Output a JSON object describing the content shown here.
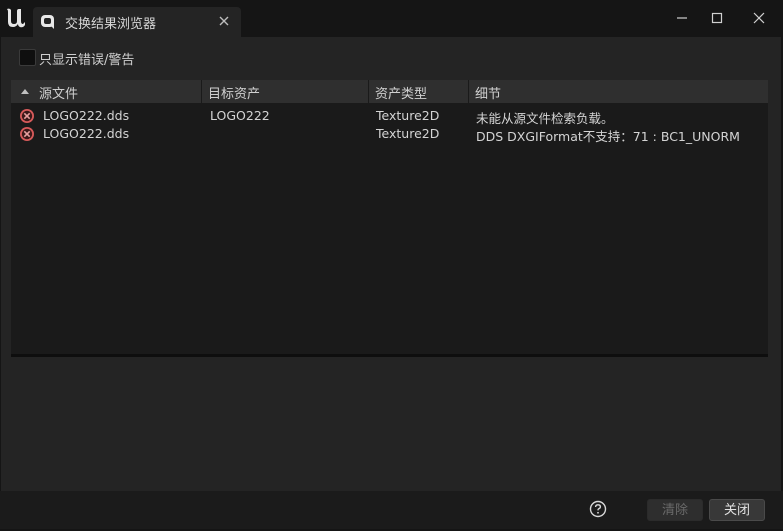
{
  "window": {
    "tab_title": "交换结果浏览器",
    "logo_icon": "unreal-logo-icon",
    "tab_icon": "message-log-icon"
  },
  "filter": {
    "checkbox_checked": false,
    "label": "只显示错误/警告"
  },
  "table": {
    "columns": [
      "源文件",
      "目标资产",
      "资产类型",
      "细节"
    ],
    "sort_column": "源文件",
    "sort_direction": "ascending",
    "rows": [
      {
        "status_icon": "error-icon",
        "source": "LOGO222.dds",
        "target": "LOGO222",
        "type": "Texture2D",
        "detail": "未能从源文件检索负载。"
      },
      {
        "status_icon": "error-icon",
        "source": "LOGO222.dds",
        "target": "",
        "type": "Texture2D",
        "detail": "DDS DXGIFormat不支持：71 : BC1_UNORM"
      }
    ]
  },
  "buttons": {
    "clear_label": "清除",
    "clear_enabled": false,
    "close_label": "关闭"
  },
  "colors": {
    "error_red": "#d65a5a",
    "background": "#242424"
  }
}
